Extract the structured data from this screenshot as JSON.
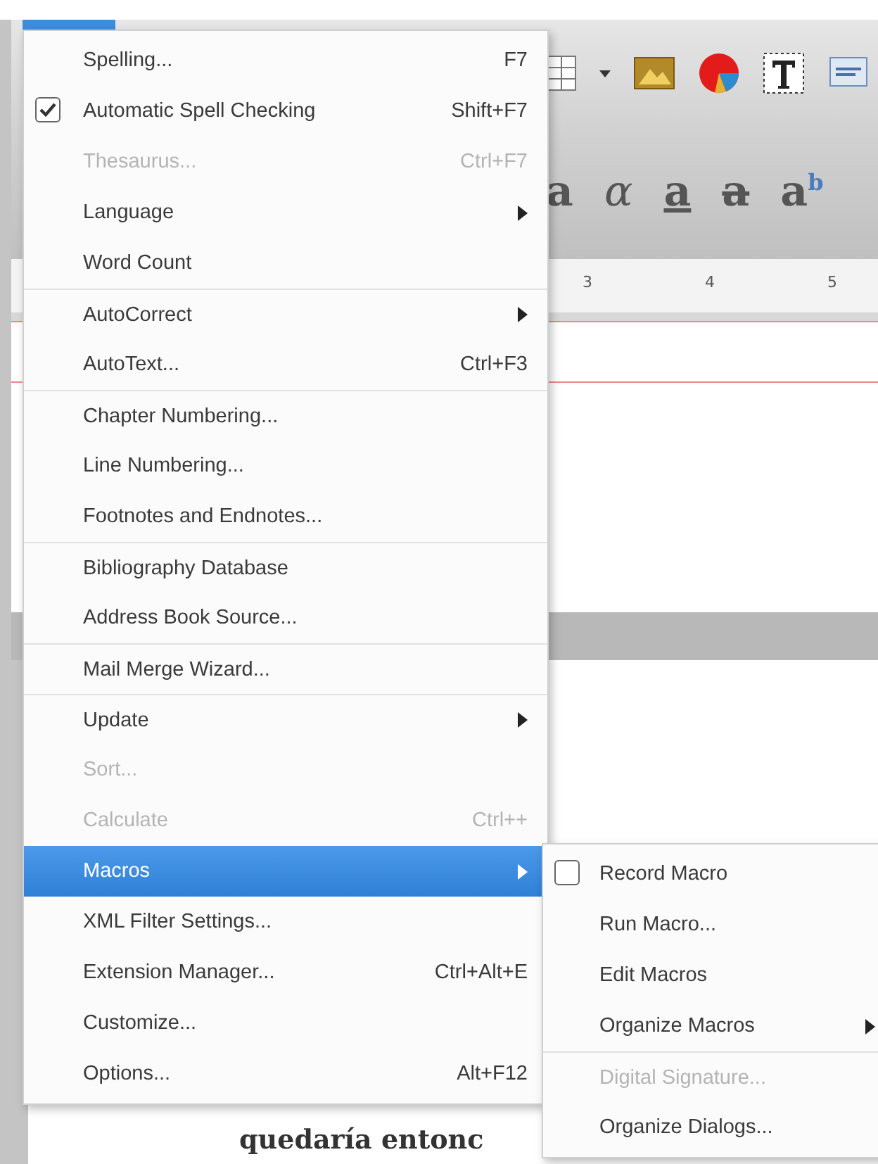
{
  "ruler": {
    "labels": [
      "3",
      "4",
      "5"
    ]
  },
  "format_glyphs": [
    {
      "kind": "bold",
      "text": "a"
    },
    {
      "kind": "italic",
      "text": "α"
    },
    {
      "kind": "underline",
      "text": "a"
    },
    {
      "kind": "strike",
      "text": "a"
    },
    {
      "kind": "super",
      "text": "a",
      "sup": "b"
    }
  ],
  "document": {
    "text": "quedaría entonc"
  },
  "menu": {
    "groups": [
      [
        {
          "label": "Spelling...",
          "shortcut": "F7",
          "kind": "plain",
          "disabled": false,
          "submenu": false,
          "selected": false
        },
        {
          "label": "Automatic Spell Checking",
          "shortcut": "Shift+F7",
          "kind": "check",
          "checked": true,
          "disabled": false,
          "submenu": false,
          "selected": false
        },
        {
          "label": "Thesaurus...",
          "shortcut": "Ctrl+F7",
          "kind": "plain",
          "disabled": true,
          "submenu": false,
          "selected": false
        },
        {
          "label": "Language",
          "kind": "plain",
          "disabled": false,
          "submenu": true,
          "selected": false
        },
        {
          "label": "Word Count",
          "kind": "plain",
          "disabled": false,
          "submenu": false,
          "selected": false
        }
      ],
      [
        {
          "label": "AutoCorrect",
          "kind": "plain",
          "disabled": false,
          "submenu": true,
          "selected": false
        },
        {
          "label": "AutoText...",
          "shortcut": "Ctrl+F3",
          "kind": "plain",
          "disabled": false,
          "submenu": false,
          "selected": false
        }
      ],
      [
        {
          "label": "Chapter Numbering...",
          "kind": "plain",
          "disabled": false,
          "submenu": false,
          "selected": false
        },
        {
          "label": "Line Numbering...",
          "kind": "plain",
          "disabled": false,
          "submenu": false,
          "selected": false
        },
        {
          "label": "Footnotes and Endnotes...",
          "kind": "plain",
          "disabled": false,
          "submenu": false,
          "selected": false
        }
      ],
      [
        {
          "label": "Bibliography Database",
          "kind": "plain",
          "disabled": false,
          "submenu": false,
          "selected": false
        },
        {
          "label": "Address Book Source...",
          "kind": "plain",
          "disabled": false,
          "submenu": false,
          "selected": false
        }
      ],
      [
        {
          "label": "Mail Merge Wizard...",
          "kind": "plain",
          "disabled": false,
          "submenu": false,
          "selected": false
        }
      ],
      [
        {
          "label": "Update",
          "kind": "plain",
          "disabled": false,
          "submenu": true,
          "selected": false
        },
        {
          "label": "Sort...",
          "kind": "plain",
          "disabled": true,
          "submenu": false,
          "selected": false
        },
        {
          "label": "Calculate",
          "shortcut": "Ctrl++",
          "kind": "plain",
          "disabled": true,
          "submenu": false,
          "selected": false
        },
        {
          "label": "Macros",
          "kind": "plain",
          "disabled": false,
          "submenu": true,
          "selected": true
        },
        {
          "label": "XML Filter Settings...",
          "kind": "plain",
          "disabled": false,
          "submenu": false,
          "selected": false
        },
        {
          "label": "Extension Manager...",
          "shortcut": "Ctrl+Alt+E",
          "kind": "plain",
          "disabled": false,
          "submenu": false,
          "selected": false
        },
        {
          "label": "Customize...",
          "kind": "plain",
          "disabled": false,
          "submenu": false,
          "selected": false
        },
        {
          "label": "Options...",
          "shortcut": "Alt+F12",
          "kind": "plain",
          "disabled": false,
          "submenu": false,
          "selected": false
        }
      ]
    ]
  },
  "submenu": {
    "groups": [
      [
        {
          "label": "Record Macro",
          "kind": "check",
          "checked": false,
          "disabled": false,
          "submenu": false,
          "selected": false
        },
        {
          "label": "Run Macro...",
          "kind": "plain",
          "disabled": false,
          "submenu": false,
          "selected": false
        },
        {
          "label": "Edit Macros",
          "kind": "plain",
          "disabled": false,
          "submenu": false,
          "selected": false
        },
        {
          "label": "Organize Macros",
          "kind": "plain",
          "disabled": false,
          "submenu": true,
          "selected": false
        }
      ],
      [
        {
          "label": "Digital Signature...",
          "kind": "plain",
          "disabled": true,
          "submenu": false,
          "selected": false
        },
        {
          "label": "Organize Dialogs...",
          "kind": "plain",
          "disabled": false,
          "submenu": false,
          "selected": false
        }
      ]
    ]
  }
}
